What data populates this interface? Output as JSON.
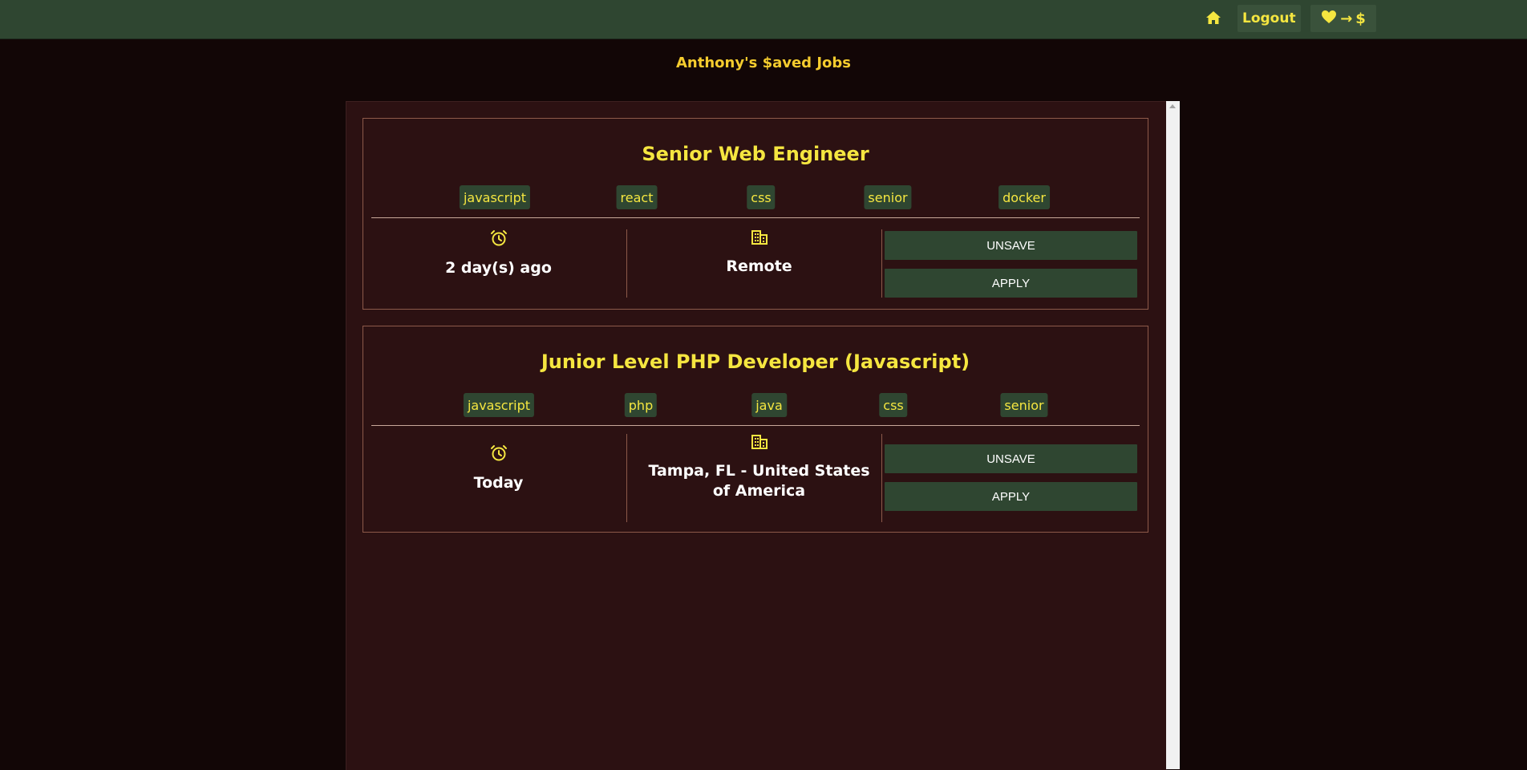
{
  "nav": {
    "home_icon": "home-icon",
    "logout_label": "Logout",
    "brand_arrow": "→",
    "brand_dollar": "$",
    "brand_heart_icon": "heart-icon"
  },
  "page": {
    "title": "Anthony's $aved Jobs"
  },
  "colors": {
    "topbar": "#2f4631",
    "background": "#120606",
    "panel": "#2c1112",
    "accent_yellow": "#f5e640",
    "title_gold": "#f5cc2e",
    "button_green": "#2f4631"
  },
  "jobs": [
    {
      "title": "Senior Web Engineer",
      "tags": [
        "javascript",
        "react",
        "css",
        "senior",
        "docker"
      ],
      "posted": "2 day(s) ago",
      "location": "Remote",
      "unsave_label": "UNSAVE",
      "apply_label": "APPLY"
    },
    {
      "title": "Junior Level PHP Developer (Javascript)",
      "tags": [
        "javascript",
        "php",
        "java",
        "css",
        "senior"
      ],
      "posted": "Today",
      "location": "Tampa, FL - United States of America",
      "unsave_label": "UNSAVE",
      "apply_label": "APPLY"
    }
  ]
}
